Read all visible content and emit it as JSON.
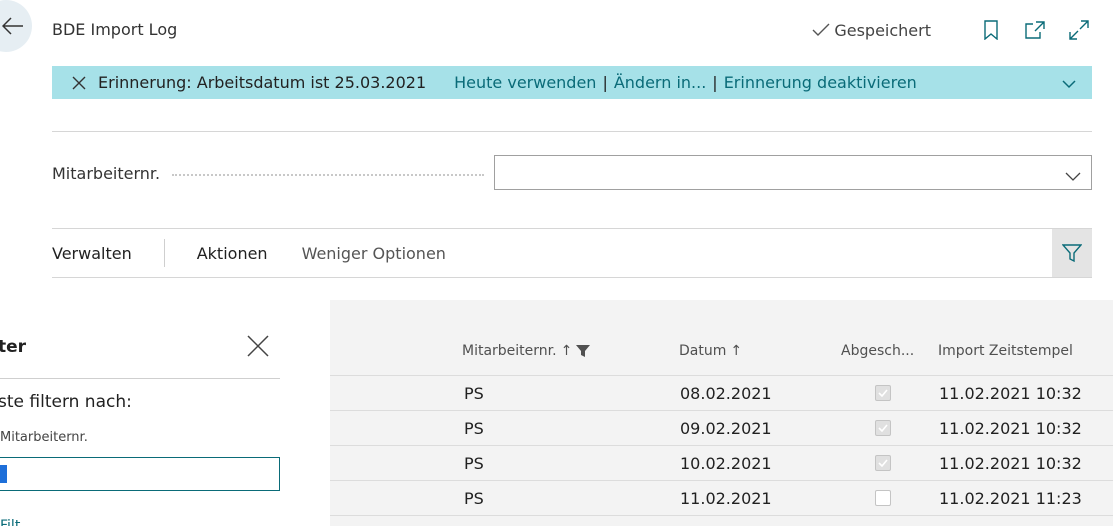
{
  "header": {
    "title": "BDE Import Log",
    "saved_label": "Gespeichert",
    "icons": [
      "back-icon",
      "bookmark-icon",
      "open-new-window-icon",
      "expand-icon",
      "check-icon"
    ]
  },
  "banner": {
    "message": "Erinnerung: Arbeitsdatum ist 25.03.2021",
    "link_use_today": "Heute verwenden",
    "link_change": "Ändern in...",
    "link_disable": "Erinnerung deaktivieren",
    "separator": "|"
  },
  "filter_field": {
    "label": "Mitarbeiternr.",
    "value": ""
  },
  "actionbar": {
    "manage": "Verwalten",
    "actions": "Aktionen",
    "fewer_options": "Weniger Optionen"
  },
  "filter_pane": {
    "title": "ter",
    "subtitle": "ste filtern nach:",
    "field_label": "Mitarbeiternr.",
    "input_value": "S",
    "add_filter": "Filt"
  },
  "table": {
    "columns": [
      "Mitarbeiternr.",
      "Datum",
      "Abgesch...",
      "Import Zeitstempel"
    ],
    "sort_indicator": "↑",
    "rows": [
      {
        "employee": "PS",
        "date": "08.02.2021",
        "closed": true,
        "timestamp": "11.02.2021 10:32"
      },
      {
        "employee": "PS",
        "date": "09.02.2021",
        "closed": true,
        "timestamp": "11.02.2021 10:32"
      },
      {
        "employee": "PS",
        "date": "10.02.2021",
        "closed": true,
        "timestamp": "11.02.2021 10:32"
      },
      {
        "employee": "PS",
        "date": "11.02.2021",
        "closed": false,
        "timestamp": "11.02.2021 11:23"
      }
    ]
  },
  "colors": {
    "banner_bg": "#a6e1e8",
    "link": "#0a6b78",
    "grid_bg": "#f3f3f3"
  }
}
